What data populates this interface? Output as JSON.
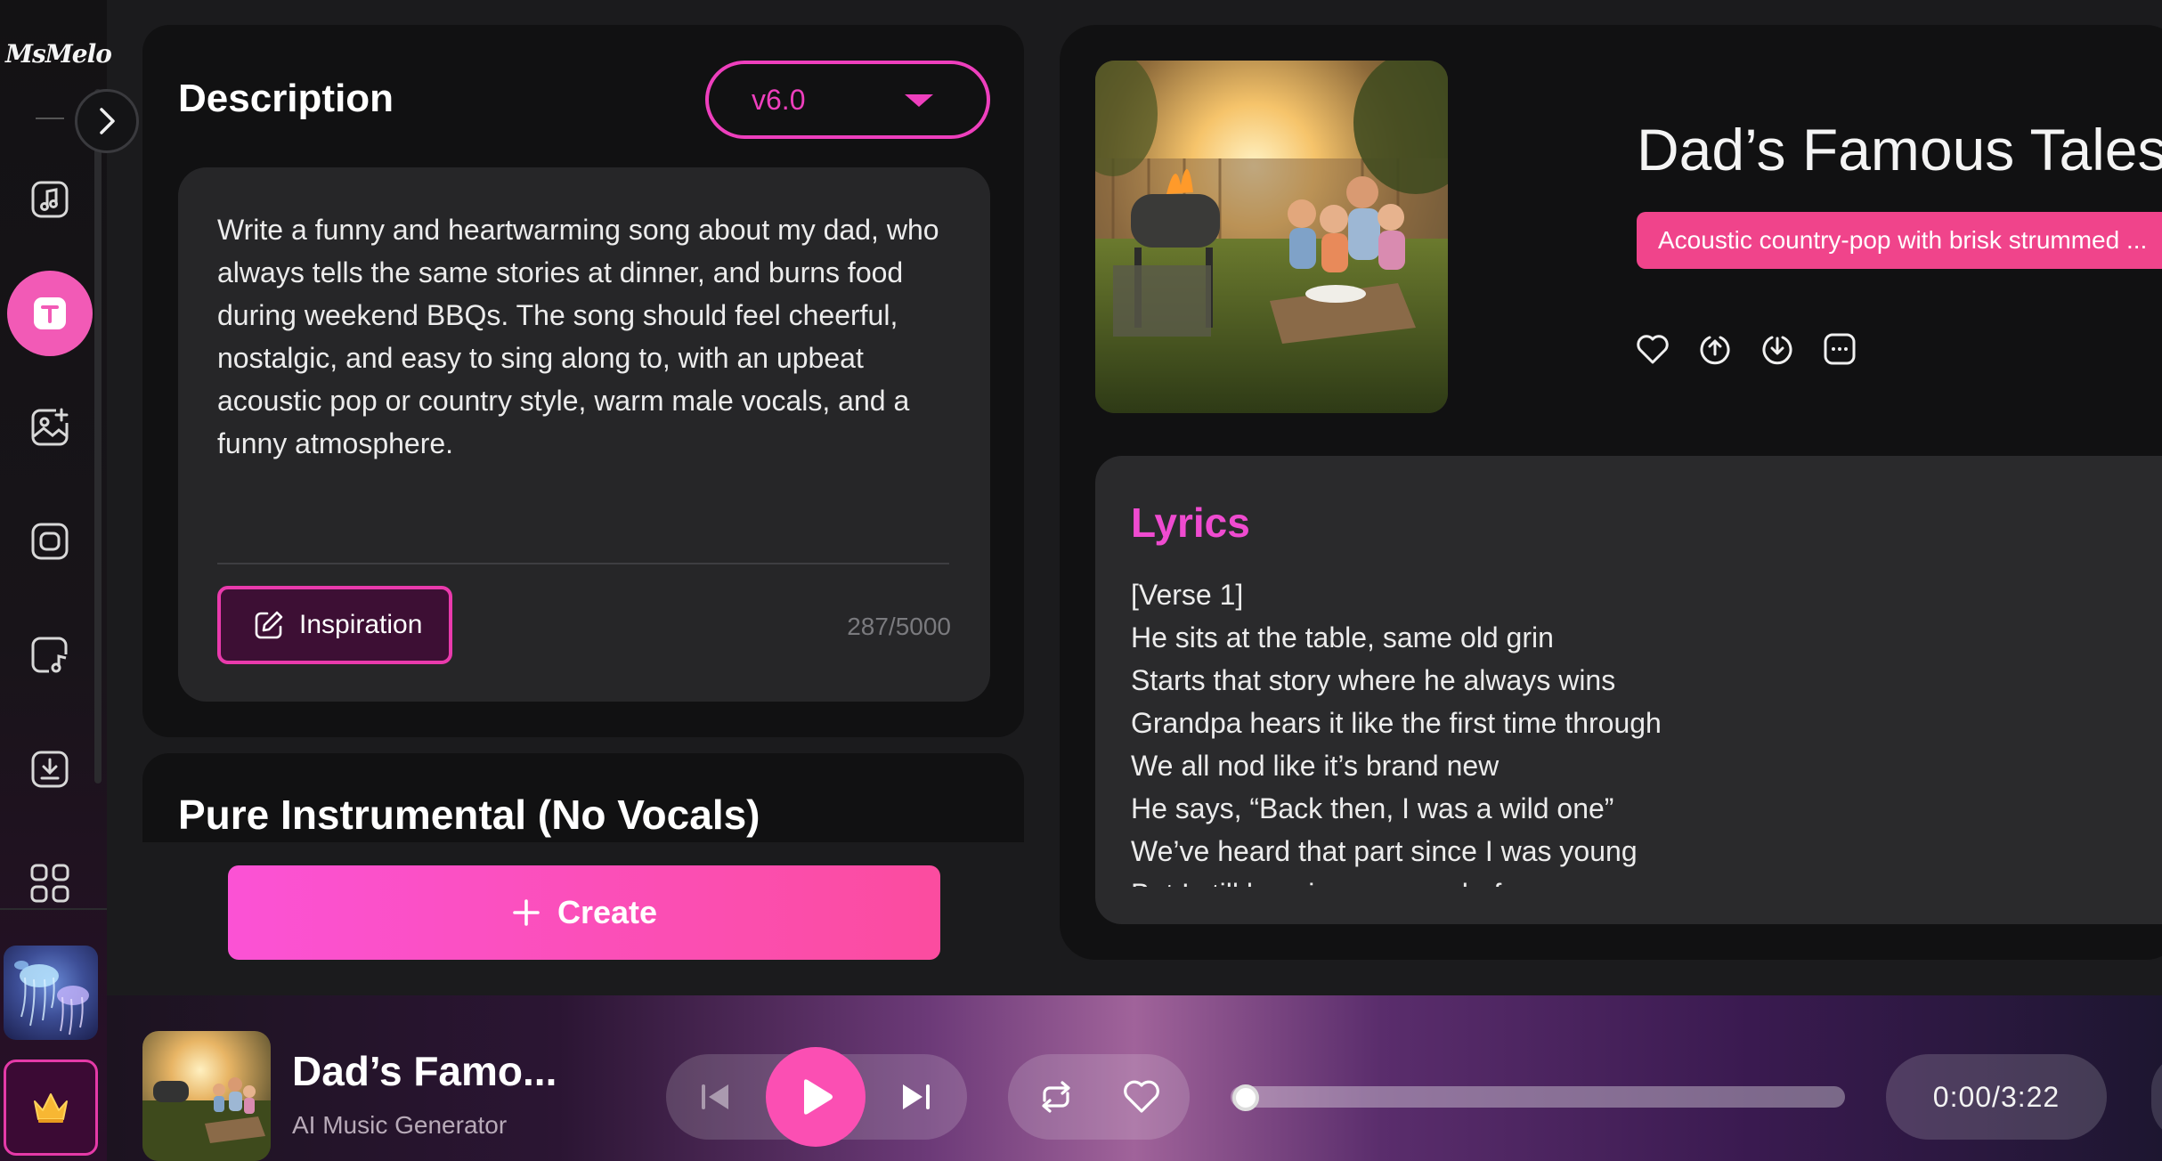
{
  "app": {
    "logo_text": "MsMelo"
  },
  "sidebar": {
    "items": [
      {
        "name": "music",
        "icon": "music-note-icon"
      },
      {
        "name": "text-to-song",
        "icon": "text-icon",
        "active": true
      },
      {
        "name": "image-to-song",
        "icon": "image-plus-icon"
      },
      {
        "name": "video",
        "icon": "video-icon"
      },
      {
        "name": "file-music",
        "icon": "file-music-icon"
      },
      {
        "name": "downloads",
        "icon": "download-icon"
      },
      {
        "name": "more",
        "icon": "grid-icon"
      }
    ]
  },
  "description": {
    "title": "Description",
    "version": "v6.0",
    "text": "Write a funny and heartwarming song about my dad, who always tells the same stories at dinner, and burns food during weekend BBQs. The song should feel cheerful, nostalgic, and easy to sing along to, with an upbeat acoustic pop or country style, warm male vocals, and a funny atmosphere.",
    "inspiration_label": "Inspiration",
    "char_count": "287/5000"
  },
  "instrumental": {
    "title": "Pure Instrumental (No Vocals)"
  },
  "create": {
    "label": "Create"
  },
  "song": {
    "title": "Dad’s Famous Tales",
    "style_tag": "Acoustic country-pop with brisk strummed ..."
  },
  "lyrics": {
    "title": "Lyrics",
    "lines": [
      "[Verse 1]",
      "He sits at the table, same old grin",
      "Starts that story where he always wins",
      "Grandpa hears it like the first time through",
      "We all nod like it’s brand new",
      "He says, “Back then, I was a wild one”",
      "We’ve heard that part since I was young",
      "But I still lean in, same as before"
    ]
  },
  "player": {
    "title": "Dad’s Famo...",
    "subtitle": "AI Music Generator",
    "time": "0:00/3:22",
    "progress": 0.0
  },
  "colors": {
    "accent": "#ee3fbd",
    "create_gradient_start": "#fb52d5",
    "create_gradient_end": "#fb4c9f",
    "style_tag": "#f0448b",
    "lyrics_title": "#ef4bd0"
  }
}
